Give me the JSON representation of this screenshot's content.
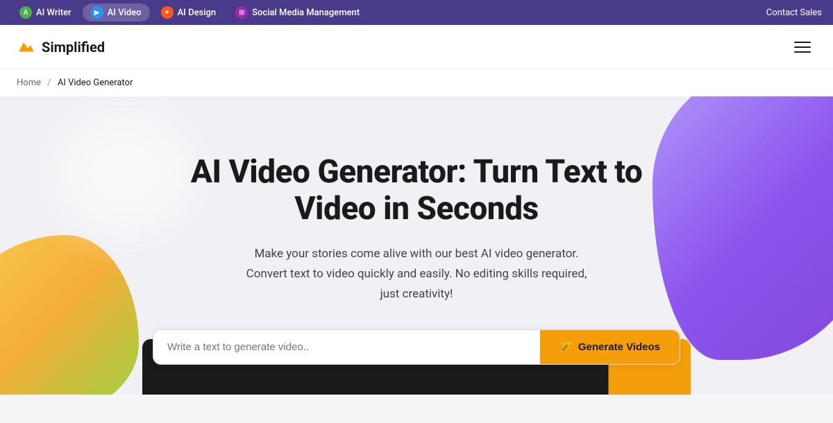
{
  "topbar": {
    "contact_sales": "Contact Sales",
    "nav_items": [
      {
        "id": "ai-writer",
        "label": "AI Writer",
        "icon_type": "writer",
        "active": false
      },
      {
        "id": "ai-video",
        "label": "AI Video",
        "icon_type": "video",
        "active": true
      },
      {
        "id": "ai-design",
        "label": "AI Design",
        "icon_type": "design",
        "active": false
      },
      {
        "id": "social-media",
        "label": "Social Media Management",
        "icon_type": "social",
        "active": false
      }
    ]
  },
  "header": {
    "logo_text": "Simplified",
    "logo_icon": "⚡"
  },
  "breadcrumb": {
    "home": "Home",
    "separator": "/",
    "current": "AI Video Generator"
  },
  "hero": {
    "title": "AI Video Generator: Turn Text to Video in Seconds",
    "subtitle_line1": "Make your stories come alive with our best AI video generator.",
    "subtitle_line2": "Convert text to video quickly and easily. No editing skills required,",
    "subtitle_line3": "just creativity!",
    "input_placeholder": "Write a text to generate video..",
    "button_label": "Generate Videos",
    "button_icon": "🪄"
  }
}
